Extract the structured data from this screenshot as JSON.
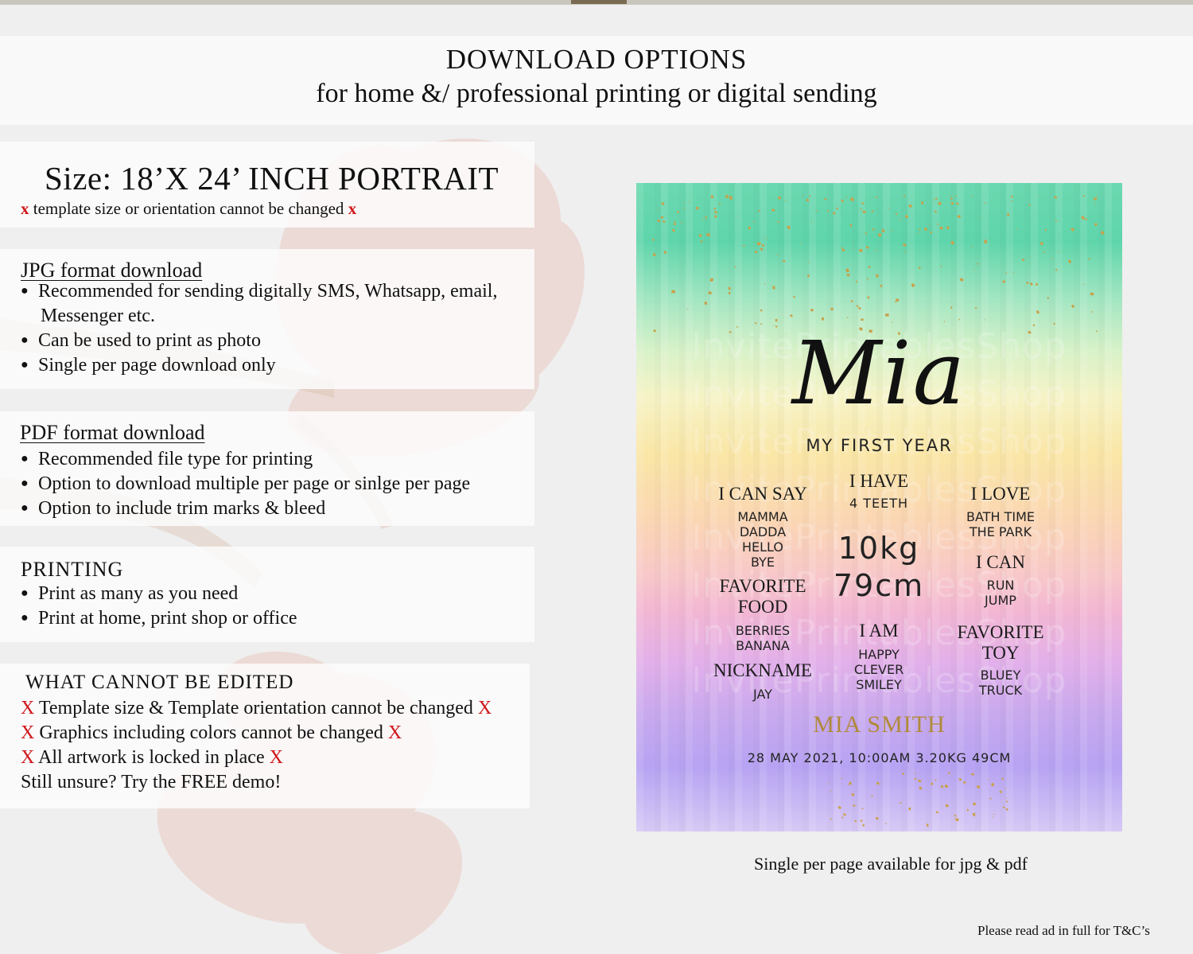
{
  "header": {
    "title": "DOWNLOAD OPTIONS",
    "subtitle": "for home &/ professional printing or digital sending"
  },
  "size_panel": {
    "title": "Size: 18’X 24’ INCH PORTRAIT",
    "x_mark": "x",
    "note": "template size or orientation cannot be changed"
  },
  "jpg_panel": {
    "title": "JPG format download",
    "bullets": [
      "Recommended for sending digitally SMS, Whatsapp, email,",
      "Can be used to print as photo",
      "Single per page download only"
    ],
    "continuation": "Messenger etc."
  },
  "pdf_panel": {
    "title": "PDF format download",
    "bullets": [
      "Recommended file type for printing",
      "Option to download multiple per page or sinlge per page",
      "Option to include trim marks & bleed"
    ]
  },
  "printing_panel": {
    "title": "PRINTING",
    "bullets": [
      "Print as many as you need",
      "Print at home, print shop or office"
    ]
  },
  "edit_panel": {
    "title": "WHAT CANNOT BE EDITED",
    "x_mark": "X",
    "lines": [
      "Template size & Template orientation cannot be changed",
      "Graphics including colors cannot be changed",
      "All artwork is locked in place"
    ],
    "final": "Still unsure? Try the FREE demo!"
  },
  "poster": {
    "watermark": "InvitePrintablesShop",
    "name_script": "Mia",
    "subtitle": "MY FIRST YEAR",
    "i_can_say": {
      "label": "I CAN SAY",
      "items": [
        "MAMMA",
        "DADDA",
        "HELLO",
        "BYE"
      ]
    },
    "i_have": {
      "label": "I HAVE",
      "items": [
        "4 TEETH"
      ]
    },
    "i_love": {
      "label": "I LOVE",
      "items": [
        "BATH TIME",
        "THE PARK"
      ]
    },
    "weight": "10kg",
    "height": "79cm",
    "i_can": {
      "label": "I CAN",
      "items": [
        "RUN",
        "JUMP"
      ]
    },
    "favorite_food": {
      "label_1": "FAVORITE",
      "label_2": "FOOD",
      "items": [
        "BERRIES",
        "BANANA"
      ]
    },
    "i_am": {
      "label": "I AM",
      "items": [
        "HAPPY",
        "CLEVER",
        "SMILEY"
      ]
    },
    "favorite_toy": {
      "label_1": "FAVORITE",
      "label_2": "TOY",
      "items": [
        "BLUEY",
        "TRUCK"
      ]
    },
    "nickname": {
      "label": "NICKNAME",
      "items": [
        "JAY"
      ]
    },
    "full_name": "MIA SMITH",
    "birth_details": "28 MAY 2021, 10:00AM 3.20KG 49CM"
  },
  "caption": "Single per page available for jpg & pdf",
  "footer": "Please read ad in full for T&C’s",
  "colors": {
    "red_x": "#d0161b",
    "gold": "#b08a3a"
  }
}
